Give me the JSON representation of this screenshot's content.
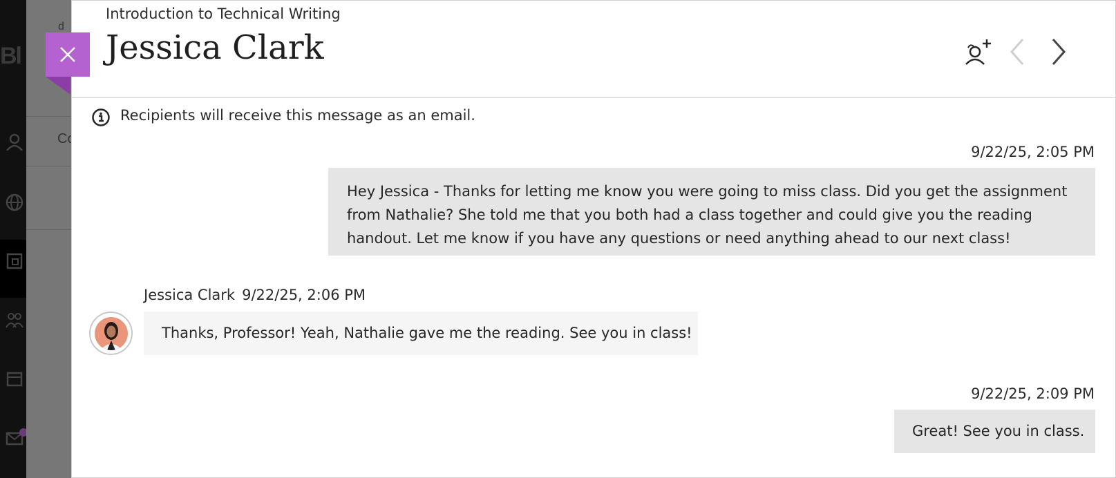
{
  "background": {
    "brand_text": "Bl",
    "content_label": "Co",
    "content_label_top": "d"
  },
  "panel": {
    "course_title": "Introduction to Technical Writing",
    "person_title": "Jessica Clark",
    "close_label": "Close",
    "info_text": "Recipients will receive this message as an email."
  },
  "messages": [
    {
      "timestamp": "9/22/25, 2:05 PM",
      "text": "Hey Jessica - Thanks for letting me know you were going to miss class. Did you get the assignment from Nathalie? She told me that you both had a class together and could give you the reading handout. Let me know if you have any questions or need anything ahead to our next class!"
    },
    {
      "sender": "Jessica Clark",
      "timestamp": "9/22/25, 2:06 PM",
      "text": "Thanks, Professor! Yeah, Nathalie gave me the reading. See you in class!"
    },
    {
      "timestamp": "9/22/25, 2:09 PM",
      "text": "Great! See you in class."
    }
  ],
  "colors": {
    "accent": "#b562d1",
    "accent_dark": "#8b3fa6",
    "sent_bubble": "#e5e5e5",
    "received_bubble": "#f5f5f5"
  },
  "icons": [
    "close-icon",
    "add-person-icon",
    "chevron-left-icon",
    "chevron-right-icon",
    "info-icon"
  ]
}
